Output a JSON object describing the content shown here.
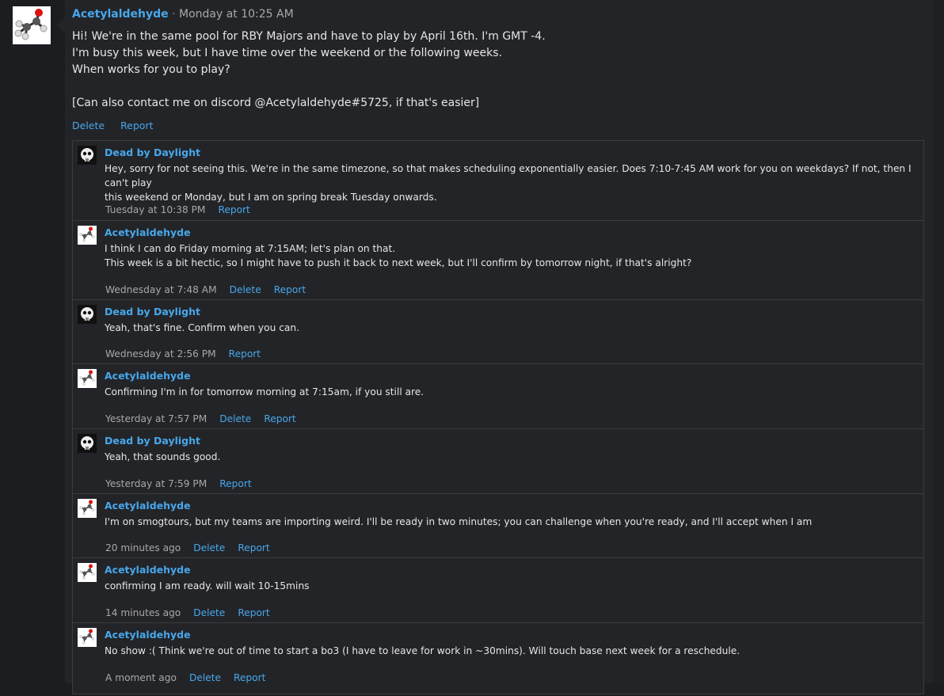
{
  "post": {
    "author": "Acetylaldehyde",
    "separator": " · ",
    "time": "Monday at 10:25 AM",
    "body": "Hi! We're in the same pool for RBY Majors and have to play by April 16th. I'm GMT -4.\nI'm busy this week, but I have time over the weekend or the following weeks.\nWhen works for you to play?\n\n[Can also contact me on discord @Acetylaldehyde#5725, if that's easier]",
    "delete_label": "Delete",
    "report_label": "Report"
  },
  "comments": [
    {
      "author": "Dead by Daylight",
      "avatar": "skull-icon",
      "text": "Hey, sorry for not seeing this. We're in the same timezone, so that makes scheduling exponentially easier. Does 7:10-7:45 AM work for you on weekdays? If not, then I can't play\nthis weekend or Monday, but I am on spring break Tuesday onwards.",
      "time": "Tuesday at 10:38 PM",
      "delete": "",
      "report": "Report"
    },
    {
      "author": "Acetylaldehyde",
      "avatar": "molecule-icon",
      "text": "I think I can do Friday morning at 7:15AM; let's plan on that.\nThis week is a bit hectic, so I might have to push it back to next week, but I'll confirm by tomorrow night, if that's alright?",
      "time": "Wednesday at 7:48 AM",
      "delete": "Delete",
      "report": "Report"
    },
    {
      "author": "Dead by Daylight",
      "avatar": "skull-icon",
      "text": "Yeah, that's fine. Confirm when you can.",
      "time": "Wednesday at 2:56 PM",
      "delete": "",
      "report": "Report"
    },
    {
      "author": "Acetylaldehyde",
      "avatar": "molecule-icon",
      "text": "Confirming I'm in for tomorrow morning at 7:15am, if you still are.",
      "time": "Yesterday at 7:57 PM",
      "delete": "Delete",
      "report": "Report"
    },
    {
      "author": "Dead by Daylight",
      "avatar": "skull-icon",
      "text": "Yeah, that sounds good.",
      "time": "Yesterday at 7:59 PM",
      "delete": "",
      "report": "Report"
    },
    {
      "author": "Acetylaldehyde",
      "avatar": "molecule-icon",
      "text": "I'm on smogtours, but my teams are importing weird. I'll be ready in two minutes; you can challenge when you're ready, and I'll accept when I am",
      "time": "20 minutes ago",
      "delete": "Delete",
      "report": "Report"
    },
    {
      "author": "Acetylaldehyde",
      "avatar": "molecule-icon",
      "text": "confirming I am ready. will wait 10-15mins",
      "time": "14 minutes ago",
      "delete": "Delete",
      "report": "Report"
    },
    {
      "author": "Acetylaldehyde",
      "avatar": "molecule-icon",
      "text": "No show :( Think we're out of time to start a bo3 (I have to leave for work in ~30mins). Will touch base next week for a reschedule.",
      "time": "A moment ago",
      "delete": "Delete",
      "report": "Report"
    }
  ],
  "colors": {
    "link": "#47a7eb",
    "background": "#232428",
    "border": "#3b3c40"
  }
}
